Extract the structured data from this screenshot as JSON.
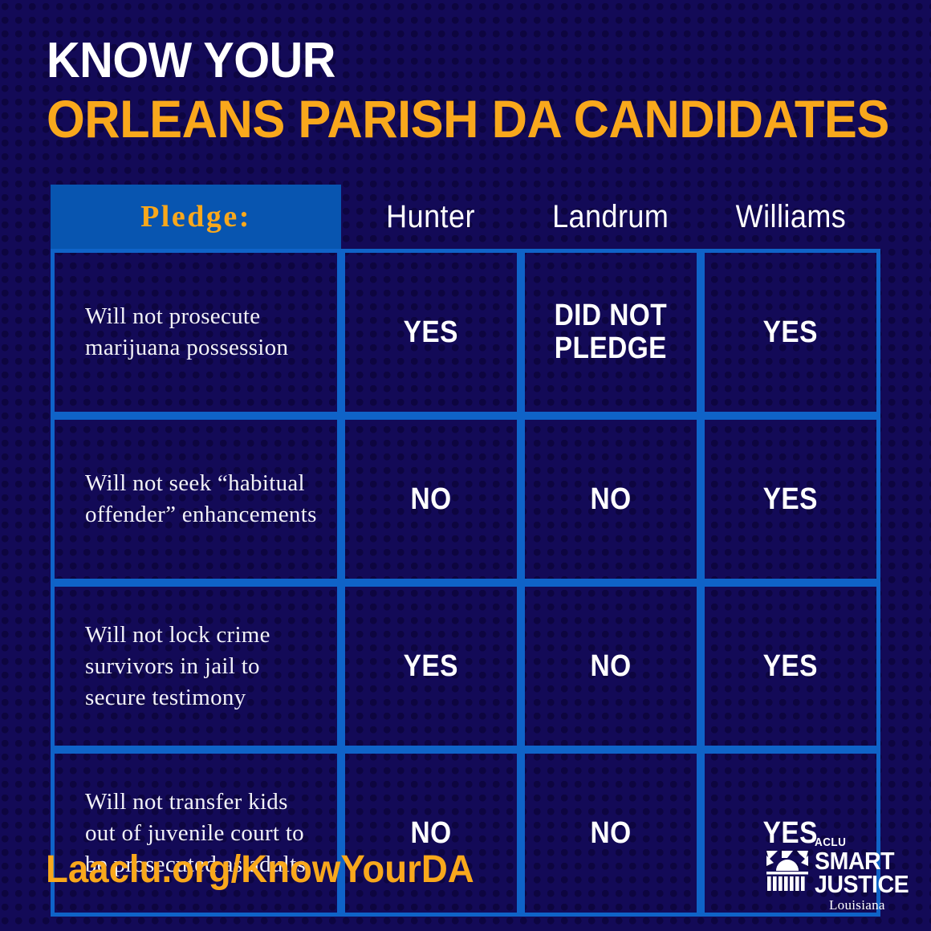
{
  "poster": {
    "background_color": "#130a57",
    "dot_color": "#0d0540",
    "accent_orange": "#f9a81c",
    "accent_blue": "#0855b0",
    "grid_blue": "#0f63c8"
  },
  "title": {
    "line1": "KNOW YOUR",
    "line2": "ORLEANS PARISH DA CANDIDATES"
  },
  "table": {
    "pledge_header": "Pledge:",
    "candidates": [
      "Hunter",
      "Landrum",
      "Williams"
    ],
    "rows": [
      {
        "pledge": "Will not prosecute marijuana possession",
        "answers": [
          "YES",
          "DID NOT\nPLEDGE",
          "YES"
        ]
      },
      {
        "pledge": "Will not seek “habitual offender” enhancements",
        "answers": [
          "NO",
          "NO",
          "YES"
        ]
      },
      {
        "pledge": "Will not lock crime survivors in jail to secure testimony",
        "answers": [
          "YES",
          "NO",
          "YES"
        ]
      },
      {
        "pledge": "Will not transfer kids out of juvenile court to be prosecuted as adults",
        "answers": [
          "NO",
          "NO",
          "YES"
        ]
      }
    ]
  },
  "footer": {
    "url": "Laaclu.org/KnowYourDA",
    "logo": {
      "org": "ACLU",
      "line1": "SMART",
      "line2": "JUSTICE",
      "state": "Louisiana"
    }
  }
}
